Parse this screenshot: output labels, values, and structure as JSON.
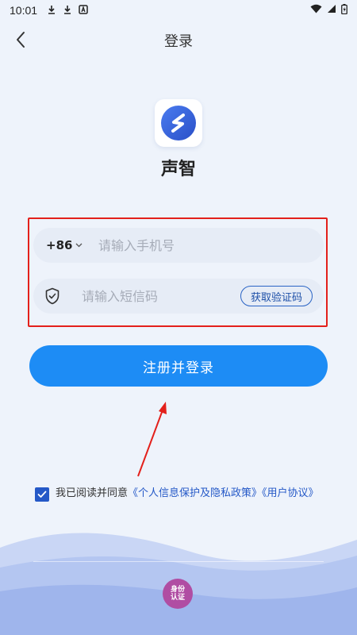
{
  "status_bar": {
    "time": "10:01",
    "left_icons": [
      "download-icon",
      "download-icon",
      "app-a-icon"
    ],
    "right_icons": [
      "wifi-icon",
      "signal-icon",
      "battery-icon"
    ]
  },
  "header": {
    "title": "登录",
    "back_icon": "chevron-left-icon"
  },
  "app": {
    "name": "声智",
    "logo_icon": "app-logo-icon"
  },
  "phone_field": {
    "country_code": "+86",
    "placeholder": "请输入手机号",
    "value": ""
  },
  "code_field": {
    "icon": "shield-check-icon",
    "placeholder": "请输入短信码",
    "value": "",
    "get_code_label": "获取验证码"
  },
  "submit": {
    "label": "注册并登录"
  },
  "agreement": {
    "checked": true,
    "prefix": "我已阅读并同意",
    "privacy_link": "《个人信息保护及隐私政策》",
    "user_link": "《用户协议》"
  },
  "footer": {
    "badge_line1": "身份",
    "badge_line2": "认证"
  },
  "colors": {
    "accent": "#1d8cf5",
    "link": "#2458c7",
    "highlight": "#e3201b",
    "background": "#eef3fb",
    "wave": "#a9bdf0"
  }
}
